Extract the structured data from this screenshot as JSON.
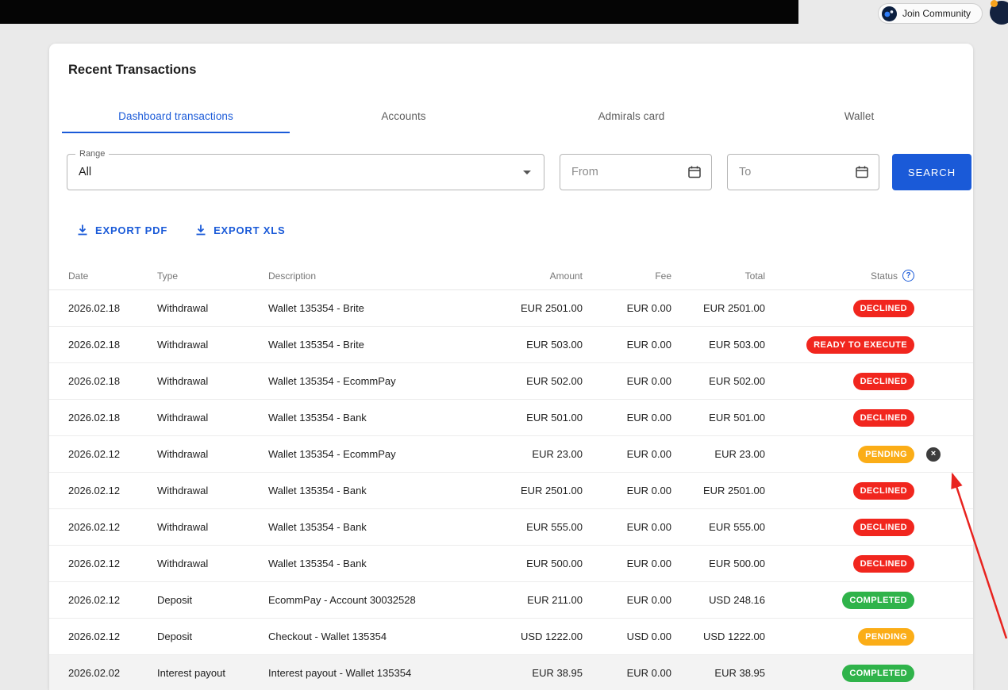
{
  "topbar": {
    "join_community_label": "Join Community"
  },
  "panel": {
    "title": "Recent Transactions",
    "tabs": [
      {
        "label": "Dashboard transactions",
        "active": true
      },
      {
        "label": "Accounts",
        "active": false
      },
      {
        "label": "Admirals card",
        "active": false
      },
      {
        "label": "Wallet",
        "active": false
      }
    ],
    "filters": {
      "range_label": "Range",
      "range_value": "All",
      "from_placeholder": "From",
      "to_placeholder": "To",
      "search_label": "SEARCH"
    },
    "exports": {
      "pdf_label": "EXPORT PDF",
      "xls_label": "EXPORT XLS"
    },
    "table": {
      "headers": [
        "Date",
        "Type",
        "Description",
        "Amount",
        "Fee",
        "Total",
        "Status"
      ],
      "rows": [
        {
          "date": "2026.02.18",
          "type": "Withdrawal",
          "description": "Wallet 135354 - Brite",
          "amount": "EUR 2501.00",
          "fee": "EUR 0.00",
          "total": "EUR 2501.00",
          "status": "DECLINED",
          "status_color": "red",
          "cancellable": false,
          "highlighted": false
        },
        {
          "date": "2026.02.18",
          "type": "Withdrawal",
          "description": "Wallet 135354 - Brite",
          "amount": "EUR 503.00",
          "fee": "EUR 0.00",
          "total": "EUR 503.00",
          "status": "READY TO EXECUTE",
          "status_color": "red",
          "cancellable": false,
          "highlighted": false
        },
        {
          "date": "2026.02.18",
          "type": "Withdrawal",
          "description": "Wallet 135354 - EcommPay",
          "amount": "EUR 502.00",
          "fee": "EUR 0.00",
          "total": "EUR 502.00",
          "status": "DECLINED",
          "status_color": "red",
          "cancellable": false,
          "highlighted": false
        },
        {
          "date": "2026.02.18",
          "type": "Withdrawal",
          "description": "Wallet 135354 - Bank",
          "amount": "EUR 501.00",
          "fee": "EUR 0.00",
          "total": "EUR 501.00",
          "status": "DECLINED",
          "status_color": "red",
          "cancellable": false,
          "highlighted": false
        },
        {
          "date": "2026.02.12",
          "type": "Withdrawal",
          "description": "Wallet 135354 - EcommPay",
          "amount": "EUR 23.00",
          "fee": "EUR 0.00",
          "total": "EUR 23.00",
          "status": "PENDING",
          "status_color": "amber",
          "cancellable": true,
          "highlighted": false
        },
        {
          "date": "2026.02.12",
          "type": "Withdrawal",
          "description": "Wallet 135354 - Bank",
          "amount": "EUR 2501.00",
          "fee": "EUR 0.00",
          "total": "EUR 2501.00",
          "status": "DECLINED",
          "status_color": "red",
          "cancellable": false,
          "highlighted": false
        },
        {
          "date": "2026.02.12",
          "type": "Withdrawal",
          "description": "Wallet 135354 - Bank",
          "amount": "EUR 555.00",
          "fee": "EUR 0.00",
          "total": "EUR 555.00",
          "status": "DECLINED",
          "status_color": "red",
          "cancellable": false,
          "highlighted": false
        },
        {
          "date": "2026.02.12",
          "type": "Withdrawal",
          "description": "Wallet 135354 - Bank",
          "amount": "EUR 500.00",
          "fee": "EUR 0.00",
          "total": "EUR 500.00",
          "status": "DECLINED",
          "status_color": "red",
          "cancellable": false,
          "highlighted": false
        },
        {
          "date": "2026.02.12",
          "type": "Deposit",
          "description": "EcommPay - Account 30032528",
          "amount": "EUR 211.00",
          "fee": "EUR 0.00",
          "total": "USD 248.16",
          "status": "COMPLETED",
          "status_color": "green",
          "cancellable": false,
          "highlighted": false
        },
        {
          "date": "2026.02.12",
          "type": "Deposit",
          "description": "Checkout - Wallet 135354",
          "amount": "USD 1222.00",
          "fee": "USD 0.00",
          "total": "USD 1222.00",
          "status": "PENDING",
          "status_color": "amber",
          "cancellable": false,
          "highlighted": false
        },
        {
          "date": "2026.02.02",
          "type": "Interest payout",
          "description": "Interest payout - Wallet 135354",
          "amount": "EUR 38.95",
          "fee": "EUR 0.00",
          "total": "EUR 38.95",
          "status": "COMPLETED",
          "status_color": "green",
          "cancellable": false,
          "highlighted": true
        }
      ]
    }
  },
  "colors": {
    "accent": "#1a5ad8",
    "declined": "#f1261e",
    "pending": "#fbad17",
    "completed": "#2fb34a"
  }
}
